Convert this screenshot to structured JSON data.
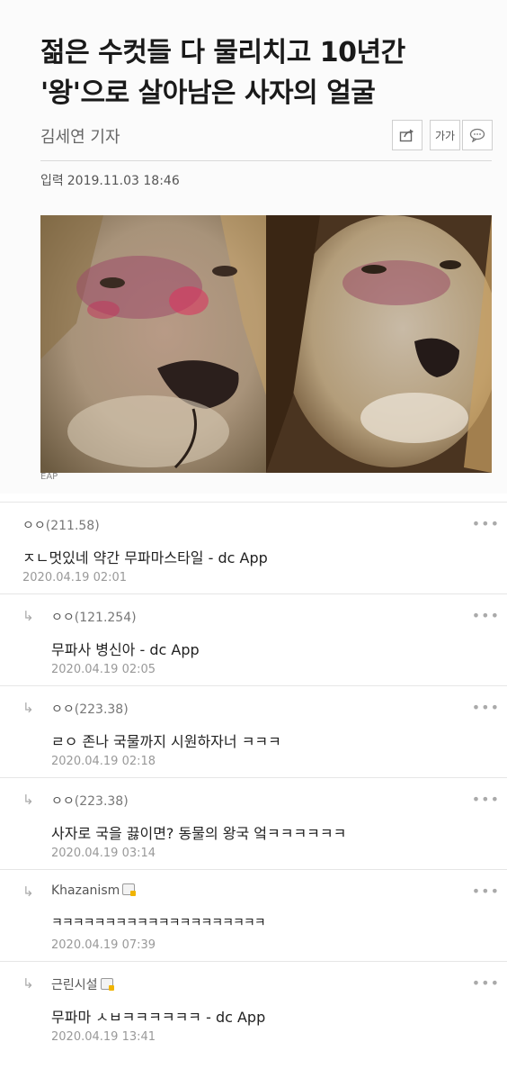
{
  "article": {
    "headline_line1": "젊은 수컷들 다 물리치고 10년간",
    "headline_line2": "'왕'으로 살아남은 사자의 얼굴",
    "reporter": "김세연 기자",
    "date_label": "입력",
    "date_value": "2019.11.03 18:46",
    "tools": {
      "share_icon": "share-icon",
      "font_size_label": "가가",
      "comment_icon": "speech-bubble-icon"
    },
    "caption_fragment": "EAP"
  },
  "comments": [
    {
      "reply": false,
      "author": "ㅇㅇ",
      "ip": "(211.58)",
      "text": "ㅈㄴ멋있네 약간 무파마스타일 - dc App",
      "date": "2020.04.19 02:01"
    },
    {
      "reply": true,
      "author": "ㅇㅇ",
      "ip": "(121.254)",
      "text": "무파사 병신아 - dc App",
      "date": "2020.04.19 02:05"
    },
    {
      "reply": true,
      "author": "ㅇㅇ",
      "ip": "(223.38)",
      "text": "ㄹㅇ 존나 국물까지 시원하자너 ㅋㅋㅋ",
      "date": "2020.04.19 02:18"
    },
    {
      "reply": true,
      "author": "ㅇㅇ",
      "ip": "(223.38)",
      "text": "사자로 국을 끓이면? 동물의 왕국 엌ㅋㅋㅋㅋㅋㅋ",
      "date": "2020.04.19 03:14"
    },
    {
      "reply": true,
      "author": "Khazanism",
      "ip": "",
      "badge": true,
      "text": "ㅋㅋㅋㅋㅋㅋㅋㅋㅋㅋㅋㅋㅋㅋㅋㅋㅋㅋㅋㅋ",
      "date": "2020.04.19 07:39"
    },
    {
      "reply": true,
      "author": "근린시설",
      "ip": "",
      "badge": true,
      "text": "무파마 ㅅㅂㅋㅋㅋㅋㅋㅋ - dc App",
      "date": "2020.04.19 13:41"
    }
  ],
  "ui": {
    "reply_arrow": "↳",
    "more_dots": "•••"
  }
}
